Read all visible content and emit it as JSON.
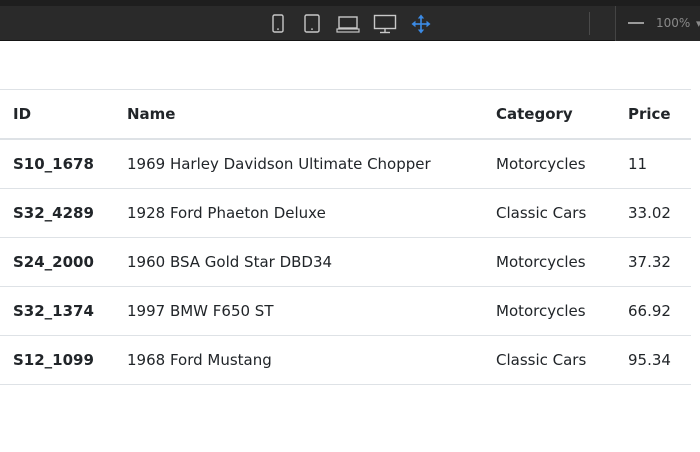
{
  "toolbar": {
    "icons": [
      "mobile-icon",
      "tablet-icon",
      "laptop-icon",
      "desktop-icon",
      "move-icon"
    ],
    "active_icon_color": "#3b8be6",
    "zoom_label": "100%"
  },
  "table": {
    "headers": {
      "id": "ID",
      "name": "Name",
      "category": "Category",
      "price": "Price"
    },
    "rows": [
      {
        "id": "S10_1678",
        "name": "1969 Harley Davidson Ultimate Chopper",
        "category": "Motorcycles",
        "price": "11"
      },
      {
        "id": "S32_4289",
        "name": "1928 Ford Phaeton Deluxe",
        "category": "Classic Cars",
        "price": "33.02"
      },
      {
        "id": "S24_2000",
        "name": "1960 BSA Gold Star DBD34",
        "category": "Motorcycles",
        "price": "37.32"
      },
      {
        "id": "S32_1374",
        "name": "1997 BMW F650 ST",
        "category": "Motorcycles",
        "price": "66.92"
      },
      {
        "id": "S12_1099",
        "name": "1968 Ford Mustang",
        "category": "Classic Cars",
        "price": "95.34"
      }
    ]
  }
}
